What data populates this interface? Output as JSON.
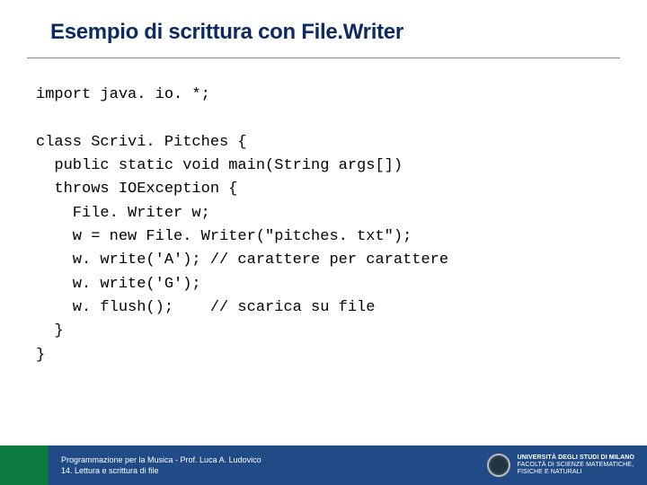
{
  "title": "Esempio di scrittura con File.Writer",
  "code": "import java. io. *;\n\nclass Scrivi. Pitches {\n  public static void main(String args[])\n  throws IOException {\n    File. Writer w;\n    w = new File. Writer(\"pitches. txt\");\n    w. write('A'); // carattere per carattere\n    w. write('G');\n    w. flush();    // scarica su file\n  }\n}",
  "footer": {
    "line1": "Programmazione per la Musica - Prof. Luca A. Ludovico",
    "line2": "14. Lettura e scrittura di file",
    "uni_name": "UNIVERSITÀ DEGLI STUDI DI MILANO",
    "faculty": "FACOLTÀ DI SCIENZE MATEMATICHE,\nFISICHE E NATURALI"
  }
}
